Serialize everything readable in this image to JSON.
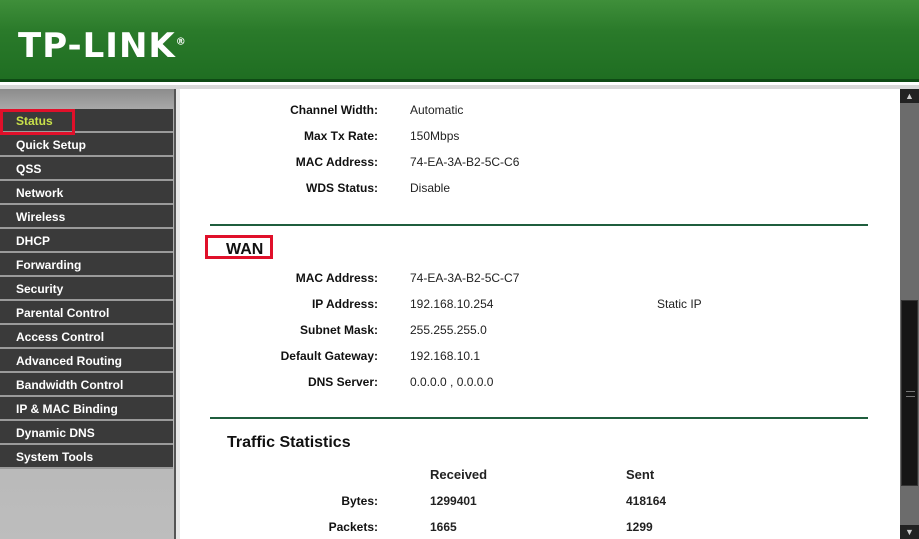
{
  "header": {
    "logo": "TP-LINK"
  },
  "sidebar": {
    "items": [
      "Status",
      "Quick Setup",
      "QSS",
      "Network",
      "Wireless",
      "DHCP",
      "Forwarding",
      "Security",
      "Parental Control",
      "Access Control",
      "Advanced Routing",
      "Bandwidth Control",
      "IP & MAC Binding",
      "Dynamic DNS",
      "System Tools"
    ],
    "active": "Status"
  },
  "wireless": [
    {
      "label": "Channel Width:",
      "value": "Automatic"
    },
    {
      "label": "Max Tx Rate:",
      "value": "150Mbps"
    },
    {
      "label": "MAC Address:",
      "value": "74-EA-3A-B2-5C-C6"
    },
    {
      "label": "WDS Status:",
      "value": "Disable"
    }
  ],
  "wan": {
    "title": "WAN",
    "rows": [
      {
        "label": "MAC Address:",
        "value": "74-EA-3A-B2-5C-C7",
        "extra": ""
      },
      {
        "label": "IP Address:",
        "value": "192.168.10.254",
        "extra": "Static IP"
      },
      {
        "label": "Subnet Mask:",
        "value": "255.255.255.0",
        "extra": ""
      },
      {
        "label": "Default Gateway:",
        "value": "192.168.10.1",
        "extra": ""
      },
      {
        "label": "DNS Server:",
        "value": "0.0.0.0 , 0.0.0.0",
        "extra": ""
      }
    ]
  },
  "traffic": {
    "title": "Traffic Statistics",
    "headers": [
      "Received",
      "Sent"
    ],
    "rows": [
      {
        "label": "Bytes:",
        "received": "1299401",
        "sent": "418164"
      },
      {
        "label": "Packets:",
        "received": "1665",
        "sent": "1299"
      }
    ]
  },
  "colors": {
    "header_green": "#2a7a2a",
    "highlight_red": "#e0102a",
    "active_text": "#c8e04a"
  }
}
